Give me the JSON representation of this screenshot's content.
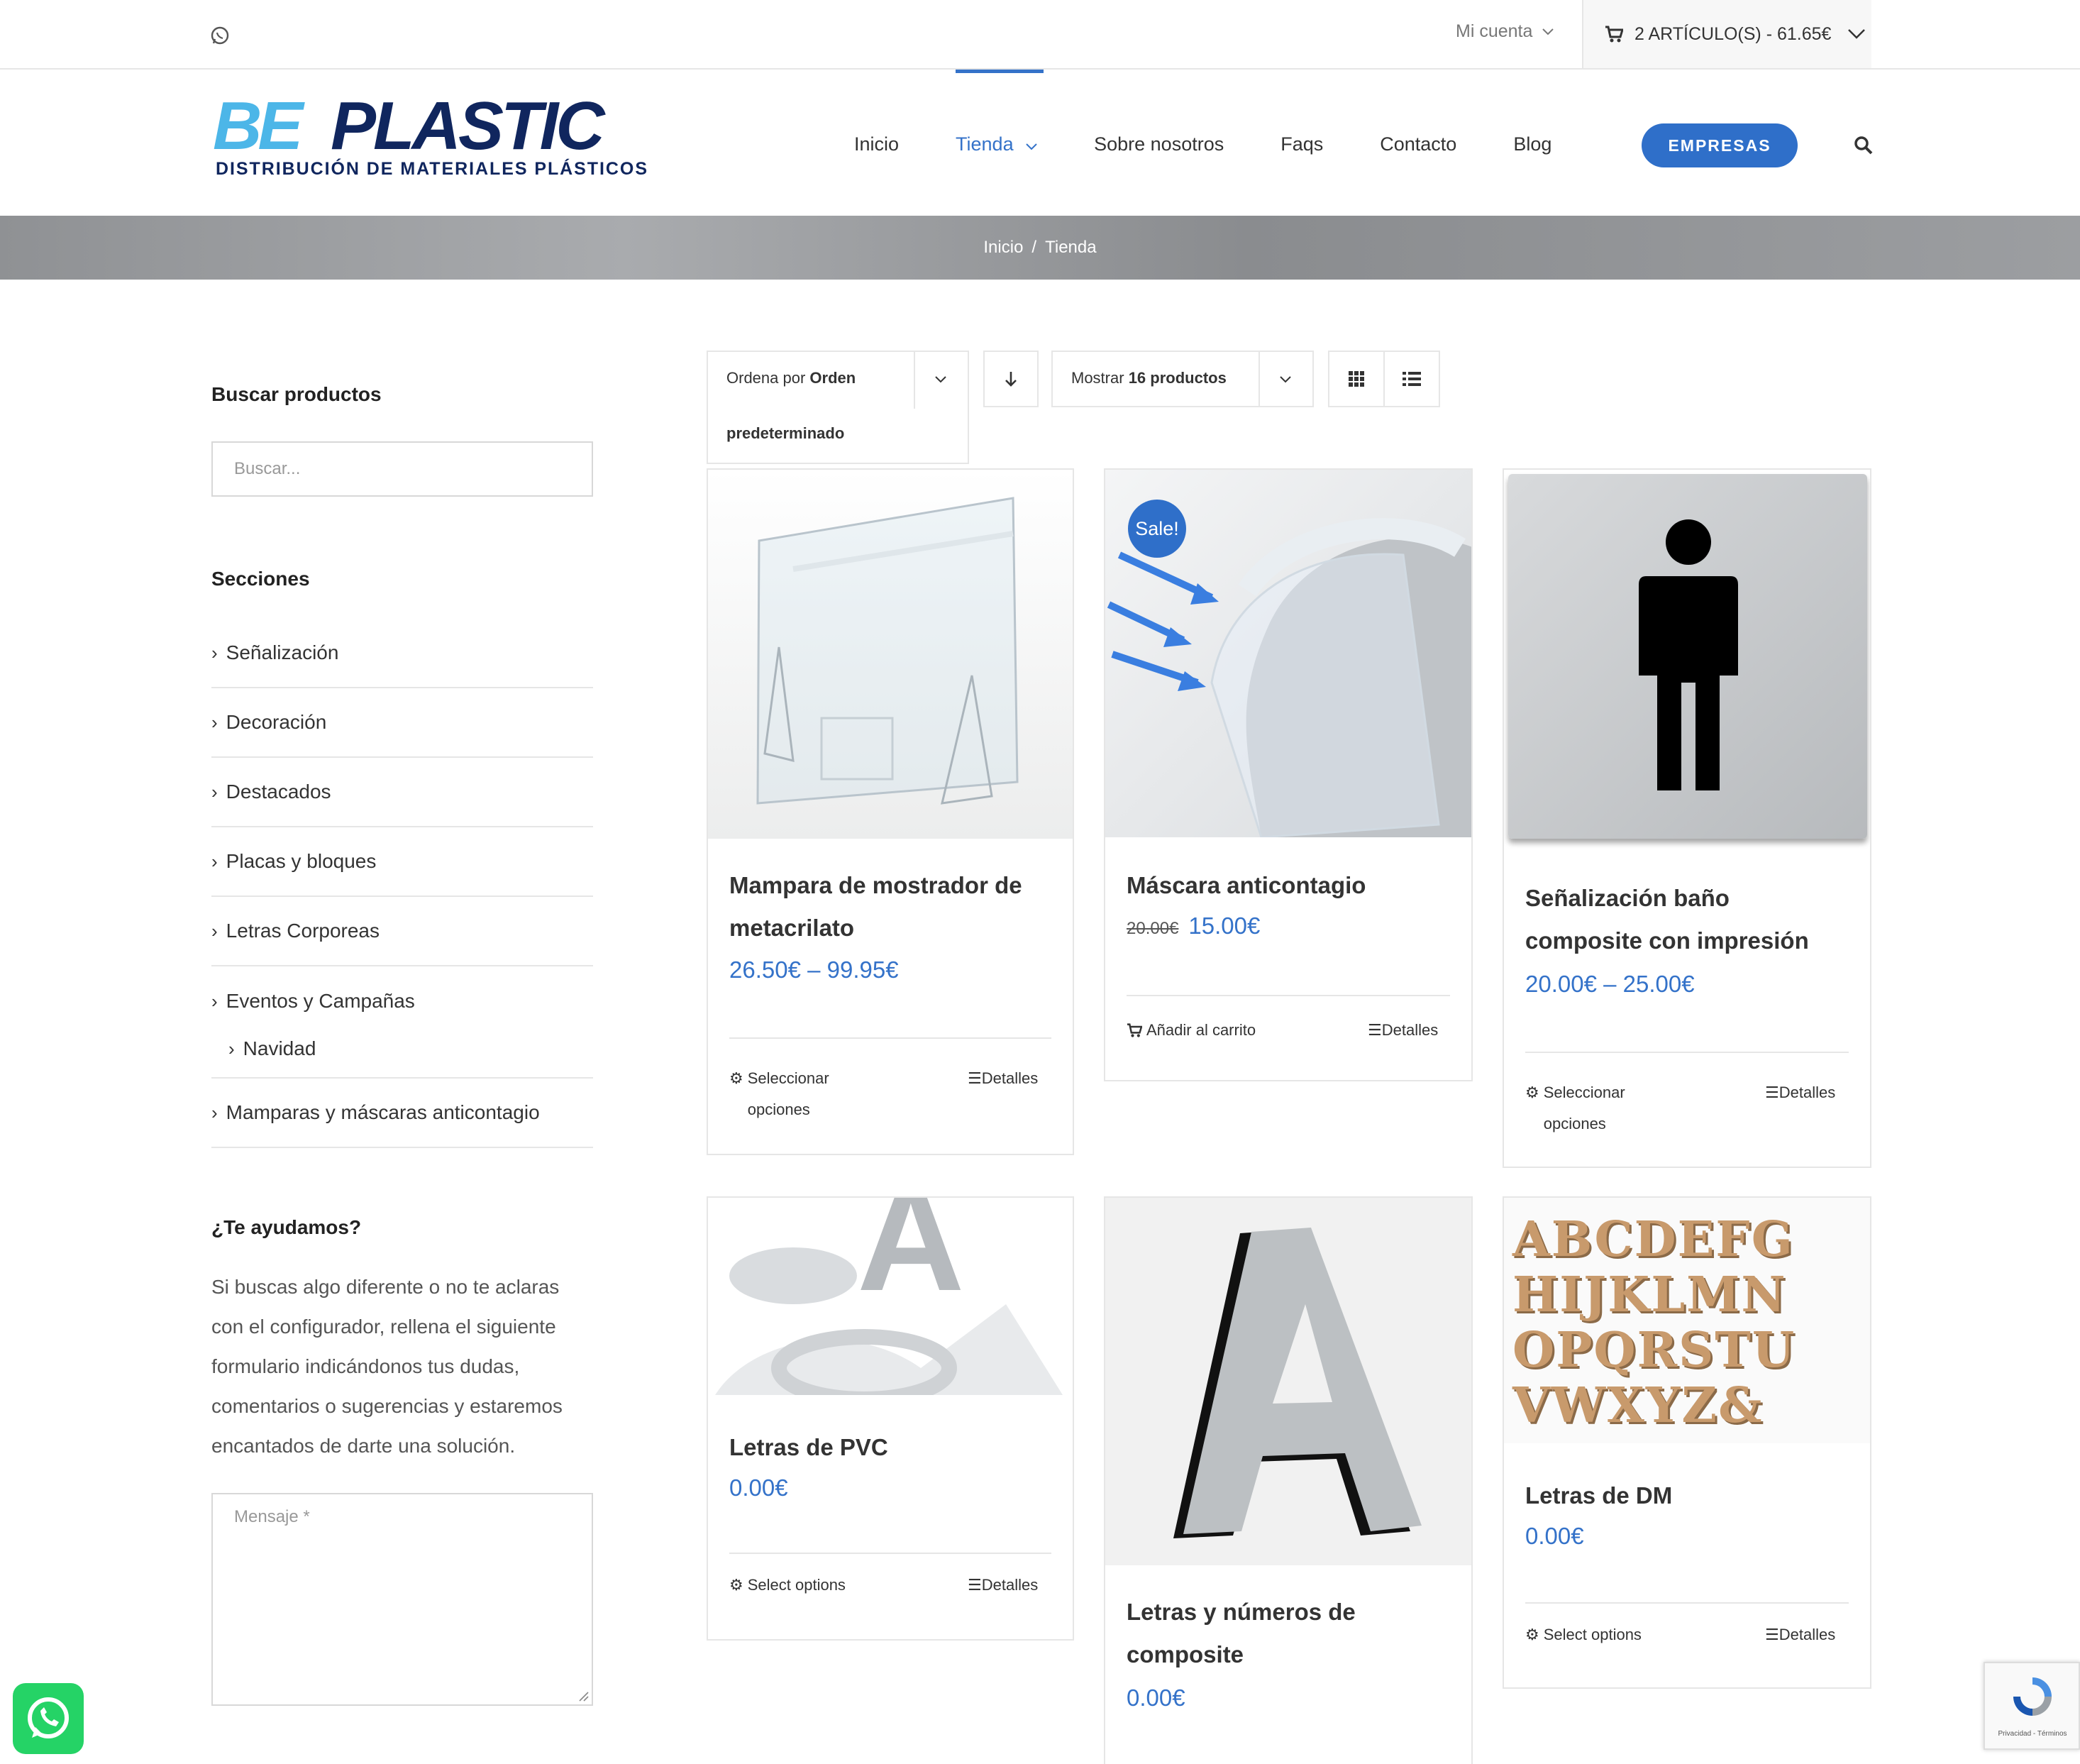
{
  "topbar": {
    "account_label": "Mi cuenta",
    "cart_label": "2 ARTÍCULO(S) - 61.65€"
  },
  "logo": {
    "line1_a": "BE",
    "line1_b": "PLASTIC",
    "line2": "DISTRIBUCIÓN DE MATERIALES PLÁSTICOS"
  },
  "nav": {
    "items": [
      "Inicio",
      "Tienda",
      "Sobre nosotros",
      "Faqs",
      "Contacto",
      "Blog"
    ],
    "cta": "EMPRESAS"
  },
  "breadcrumb": {
    "home": "Inicio",
    "sep": "/",
    "current": "Tienda"
  },
  "sidebar": {
    "search_title": "Buscar productos",
    "search_placeholder": "Buscar...",
    "sections_title": "Secciones",
    "sections": [
      "Señalización",
      "Decoración",
      "Destacados",
      "Placas y bloques",
      "Letras Corporeas",
      "Eventos y Campañas",
      "Navidad",
      "Mamparas y máscaras anticontagio"
    ],
    "help_title": "¿Te ayudamos?",
    "help_text": "Si buscas algo diferente o no te aclaras con el configurador, rellena el siguiente formulario indicándonos tus dudas, comentarios o sugerencias y estaremos encantados de darte una solución.",
    "message_placeholder": "Mensaje *"
  },
  "toolbar": {
    "order_prefix": "Ordena por",
    "order_value_1": "Orden",
    "order_value_2": "predeterminado",
    "show_prefix": "Mostrar",
    "show_value": "16 productos"
  },
  "products": [
    {
      "title": "Mampara de mostrador de metacrilato",
      "price": "26.50€ – 99.95€",
      "action": "Seleccionar opciones",
      "details": "Detalles"
    },
    {
      "title": "Máscara anticontagio",
      "old_price": "20.00€",
      "price": "15.00€",
      "badge": "Sale!",
      "action": "Añadir al carrito",
      "details": "Detalles"
    },
    {
      "title": "Señalización baño composite con impresión",
      "price": "20.00€ – 25.00€",
      "action": "Seleccionar opciones",
      "details": "Detalles"
    },
    {
      "title": "Letras de PVC",
      "price": "0.00€",
      "action": "Select options",
      "details": "Detalles"
    },
    {
      "title": "Letras y números de composite",
      "price": "0.00€"
    },
    {
      "title": "Letras de DM",
      "price": "0.00€",
      "action": "Select options",
      "details": "Detalles"
    }
  ],
  "dm_letters": [
    "ABCDEFG",
    "HIJKLMN",
    "OPQRSTU",
    "VWXYZ&"
  ],
  "pvc_letter": "A",
  "composite_letter": "A",
  "recaptcha": "Privacidad - Términos",
  "colors": {
    "accent": "#2f6fc9",
    "link": "#3472c9",
    "whatsapp": "#25d366"
  }
}
